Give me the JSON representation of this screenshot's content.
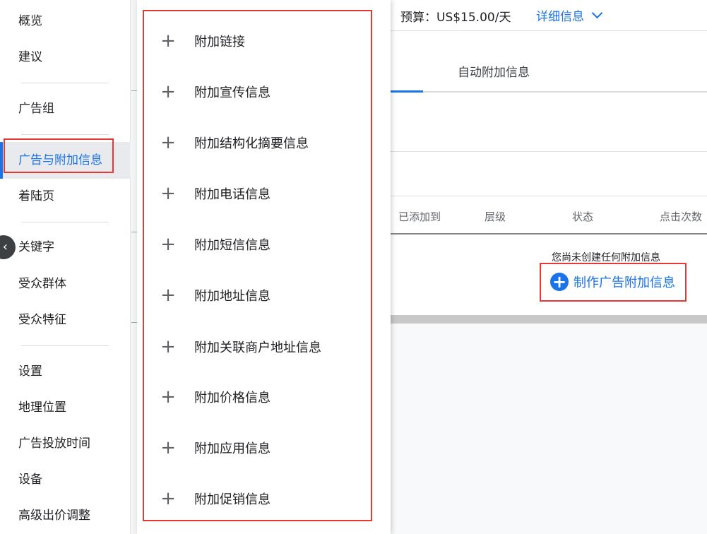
{
  "sidebar": {
    "items": [
      {
        "label": "概览"
      },
      {
        "label": "建议"
      },
      {
        "label": "广告组"
      },
      {
        "label": "广告与附加信息"
      },
      {
        "label": "着陆页"
      },
      {
        "label": "关键字"
      },
      {
        "label": "受众群体"
      },
      {
        "label": "受众特征"
      },
      {
        "label": "设置"
      },
      {
        "label": "地理位置"
      },
      {
        "label": "广告投放时间"
      },
      {
        "label": "设备"
      },
      {
        "label": "高级出价调整"
      }
    ],
    "active_index": 3,
    "collapse_glyph": "‹"
  },
  "header": {
    "budget": "预算：US$15.00/天",
    "details_label": "详细信息"
  },
  "tabs": {
    "auto_extensions": "自动附加信息"
  },
  "table": {
    "headers": [
      "已添加到",
      "层级",
      "状态",
      "点击次数"
    ]
  },
  "empty_state": {
    "message": "您尚未创建任何附加信息",
    "create_label": "制作广告附加信息",
    "create_glyph": "+"
  },
  "menu": {
    "plus_glyph": "+",
    "items": [
      {
        "label": "附加链接"
      },
      {
        "label": "附加宣传信息"
      },
      {
        "label": "附加结构化摘要信息"
      },
      {
        "label": "附加电话信息"
      },
      {
        "label": "附加短信信息"
      },
      {
        "label": "附加地址信息"
      },
      {
        "label": "附加关联商户地址信息"
      },
      {
        "label": "附加价格信息"
      },
      {
        "label": "附加应用信息"
      },
      {
        "label": "附加促销信息"
      }
    ]
  },
  "colors": {
    "accent": "#1a73e8",
    "highlight": "#e53935",
    "text": "#202124",
    "muted": "#5f6368"
  },
  "icons": {
    "menu_item": "plus-icon",
    "create_button": "plus-circle-icon",
    "details_toggle": "chevron-down-icon",
    "collapse": "chevron-left-icon"
  }
}
